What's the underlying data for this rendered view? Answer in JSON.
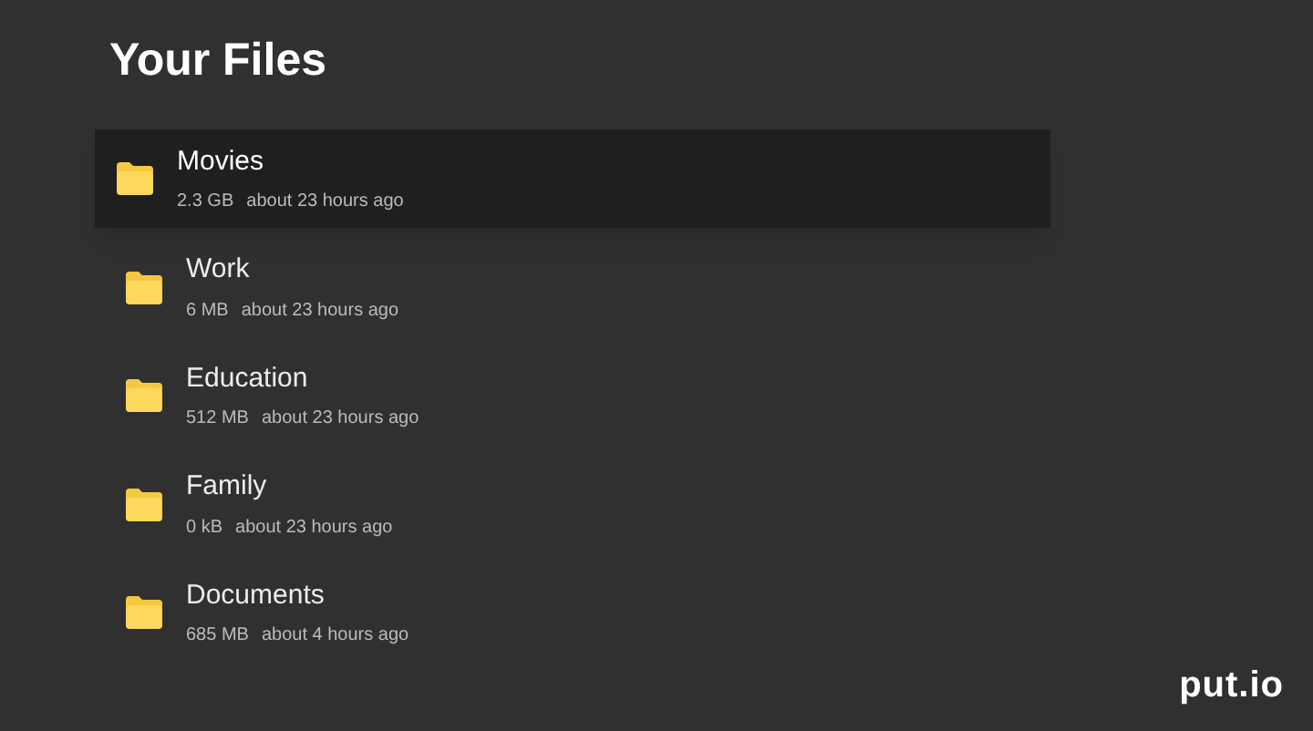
{
  "title": "Your Files",
  "files": [
    {
      "name": "Movies",
      "size": "2.3 GB",
      "modified": "about 23 hours ago",
      "selected": true
    },
    {
      "name": "Work",
      "size": "6 MB",
      "modified": "about 23 hours ago",
      "selected": false
    },
    {
      "name": "Education",
      "size": "512 MB",
      "modified": "about 23 hours ago",
      "selected": false
    },
    {
      "name": "Family",
      "size": "0 kB",
      "modified": "about 23 hours ago",
      "selected": false
    },
    {
      "name": "Documents",
      "size": "685 MB",
      "modified": "about 4 hours ago",
      "selected": false
    }
  ],
  "logo": "put.io"
}
